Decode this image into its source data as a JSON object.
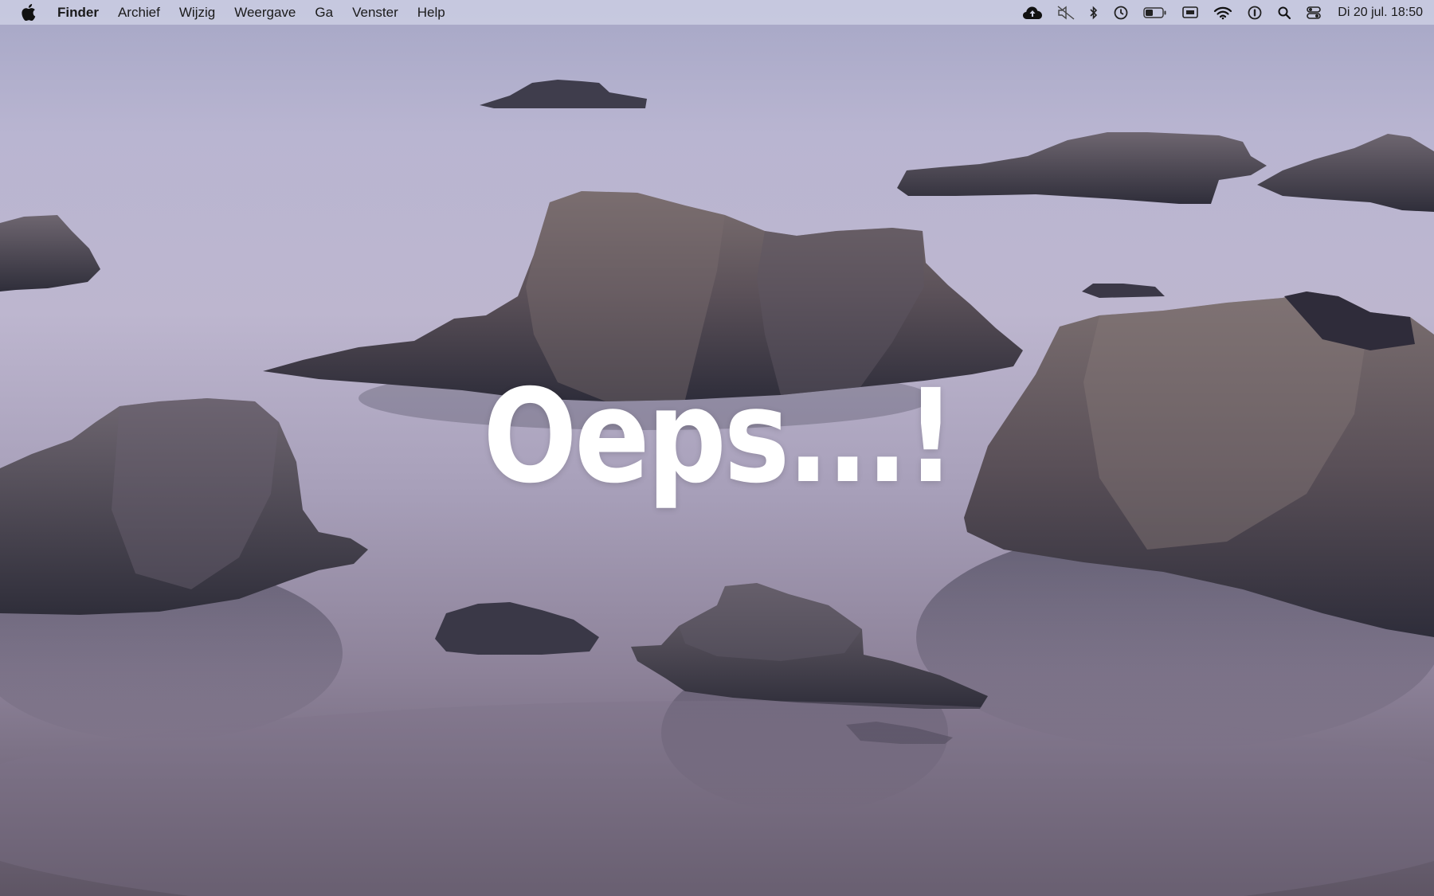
{
  "menubar": {
    "apple_icon": "apple-logo-icon",
    "items": [
      {
        "label": "Finder",
        "app": true
      },
      {
        "label": "Archief"
      },
      {
        "label": "Wijzig"
      },
      {
        "label": "Weergave"
      },
      {
        "label": "Ga"
      },
      {
        "label": "Venster"
      },
      {
        "label": "Help"
      }
    ],
    "status_icons": [
      "icloud-upload-icon",
      "mute-icon",
      "bluetooth-icon",
      "time-machine-icon",
      "battery-icon",
      "screen-display-icon",
      "wifi-icon",
      "user-icon",
      "search-icon",
      "control-center-icon"
    ],
    "clock": "Di 20 jul.  18:50"
  },
  "overlay": {
    "headline": "Oeps...!"
  },
  "colors": {
    "menubar_bg": "#cdd0e4",
    "headline": "#ffffff"
  }
}
